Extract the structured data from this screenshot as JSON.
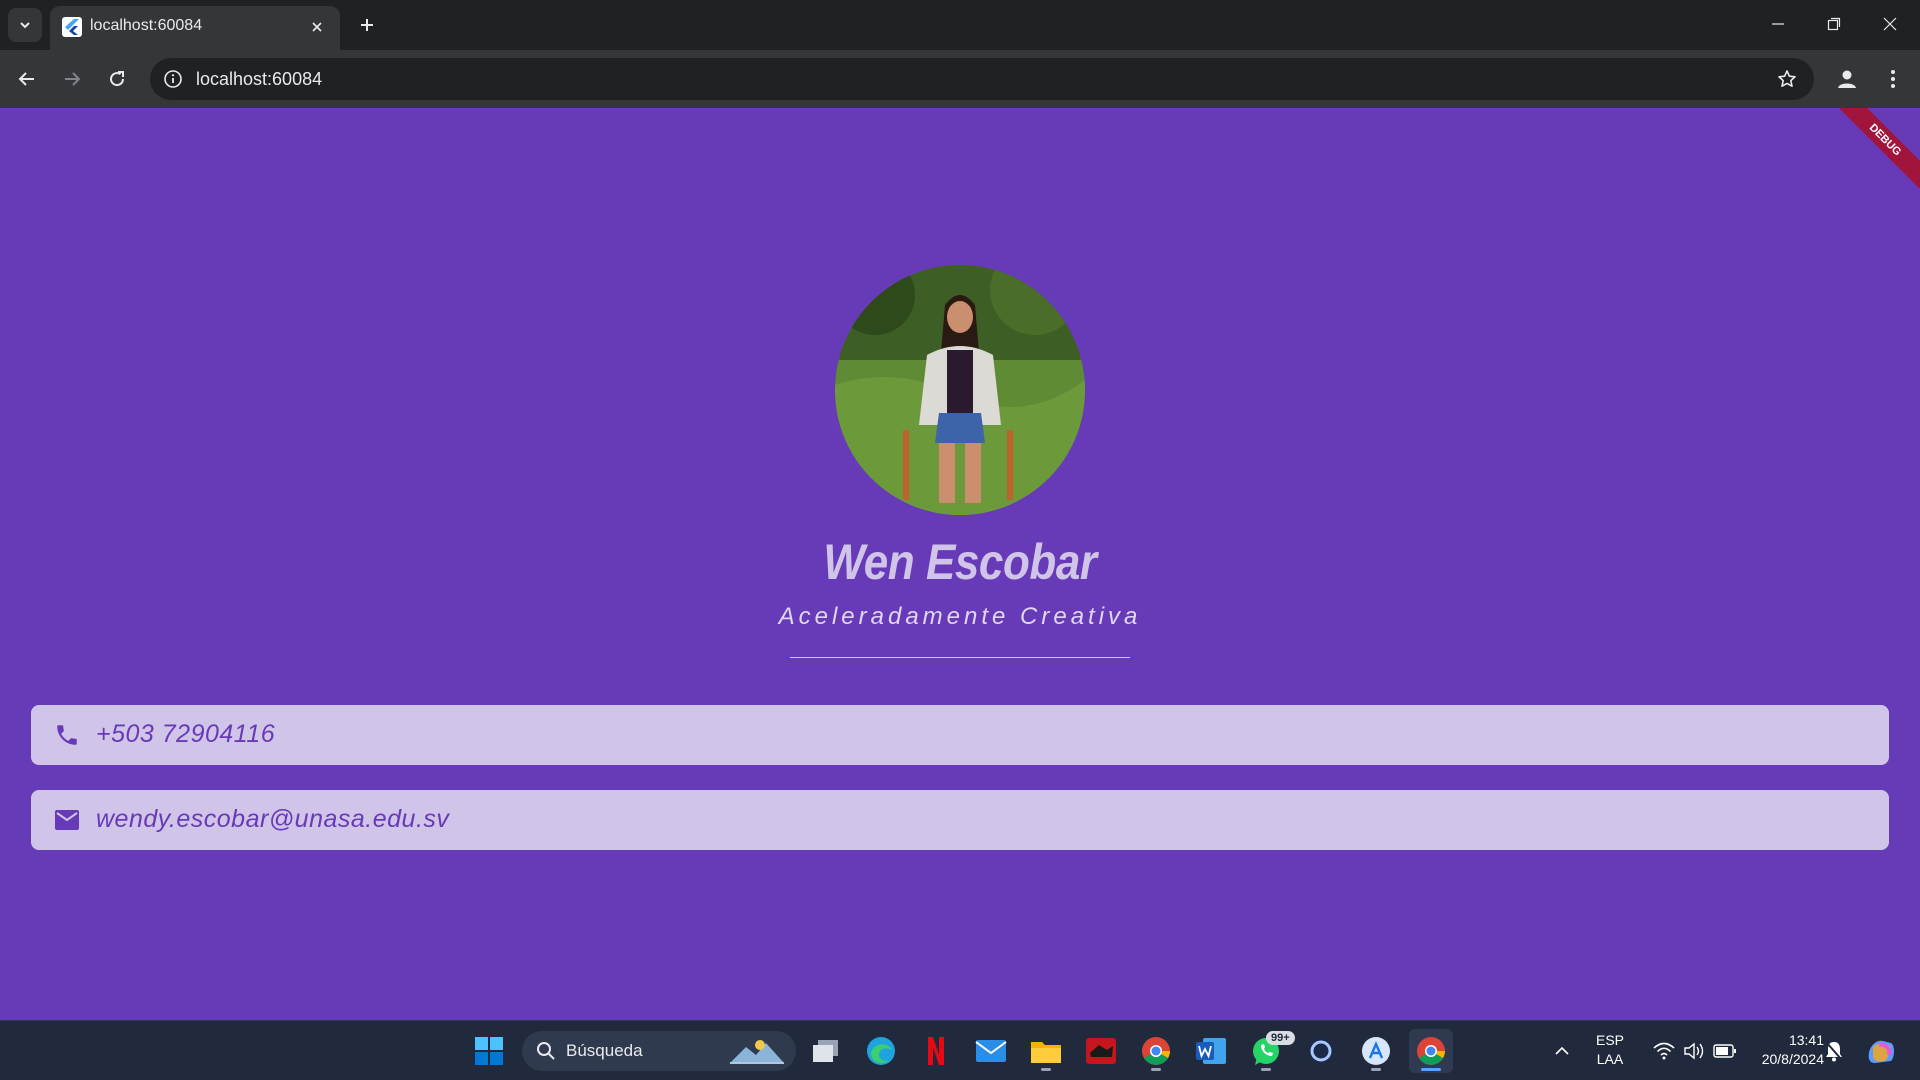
{
  "browser": {
    "tab_title": "localhost:60084",
    "url": "localhost:60084"
  },
  "app": {
    "debug_label": "DEBUG",
    "name": "Wen Escobar",
    "title": "Aceleradamente Creativa",
    "contacts": [
      {
        "icon": "phone-icon",
        "value": "+503 72904116"
      },
      {
        "icon": "mail-icon",
        "value": "wendy.escobar@unasa.edu.sv"
      }
    ],
    "colors": {
      "background": "#673ab7",
      "card": "#d1c4e9",
      "accent": "#673ab7"
    }
  },
  "taskbar": {
    "search_placeholder": "Búsqueda",
    "whatsapp_badge": "99+",
    "language": "ESP",
    "keyboard": "LAA",
    "time": "13:41",
    "date": "20/8/2024"
  }
}
